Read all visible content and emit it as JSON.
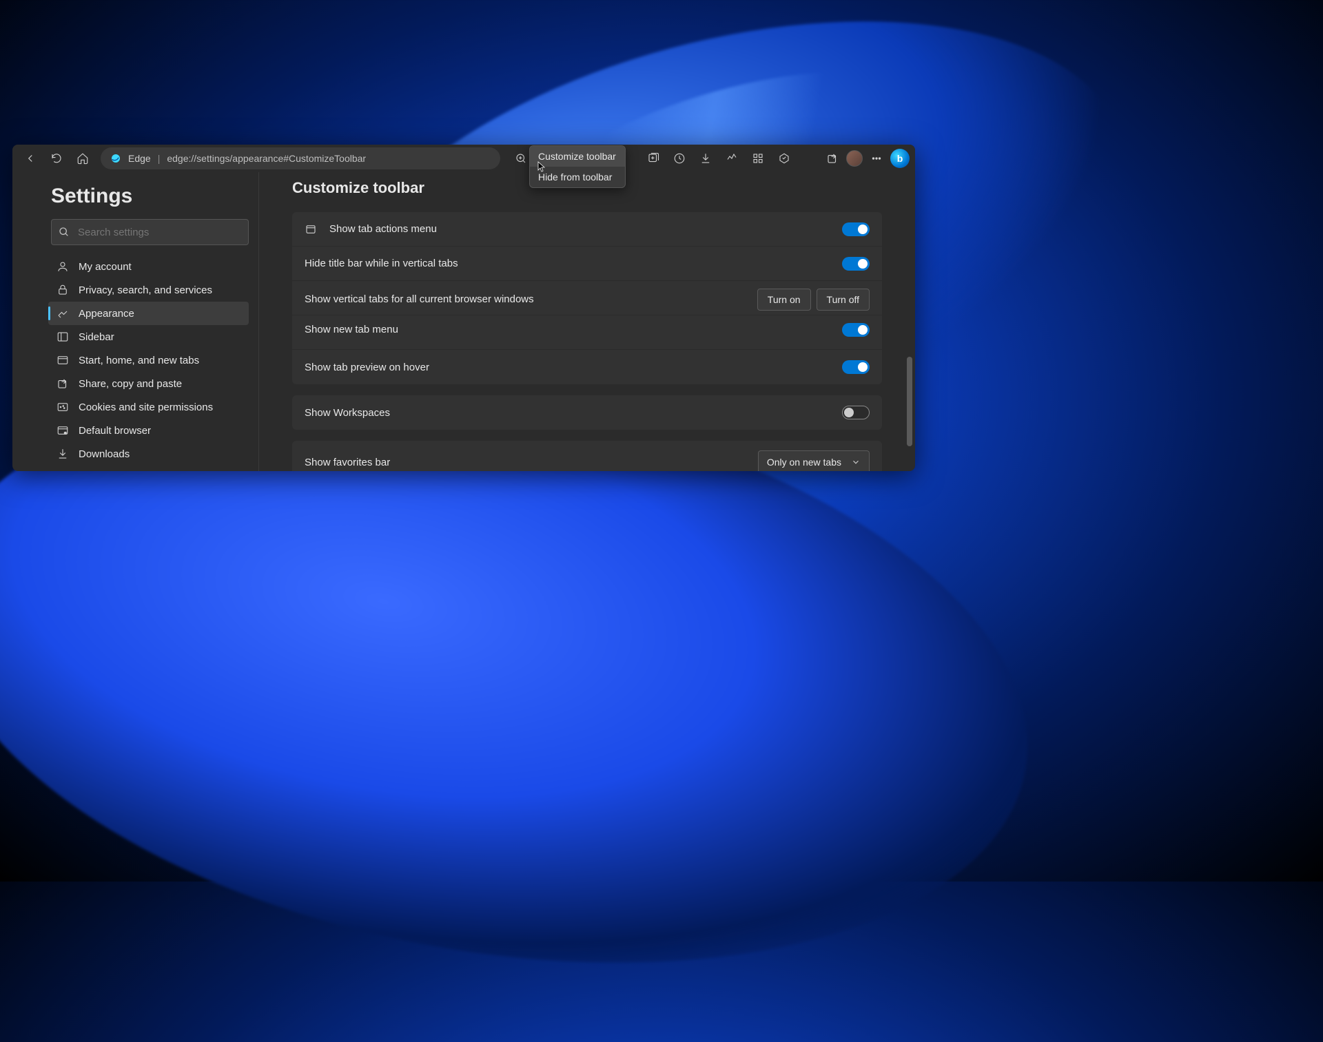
{
  "toolbar": {
    "edge_label": "Edge",
    "url": "edge://settings/appearance#CustomizeToolbar"
  },
  "context_menu": {
    "items": [
      {
        "label": "Customize toolbar"
      },
      {
        "label": "Hide from toolbar"
      }
    ]
  },
  "sidebar": {
    "title": "Settings",
    "search_placeholder": "Search settings",
    "items": [
      {
        "label": "My account"
      },
      {
        "label": "Privacy, search, and services"
      },
      {
        "label": "Appearance"
      },
      {
        "label": "Sidebar"
      },
      {
        "label": "Start, home, and new tabs"
      },
      {
        "label": "Share, copy and paste"
      },
      {
        "label": "Cookies and site permissions"
      },
      {
        "label": "Default browser"
      },
      {
        "label": "Downloads"
      }
    ]
  },
  "main": {
    "heading": "Customize toolbar",
    "rows": {
      "tab_actions": "Show tab actions menu",
      "hide_title": "Hide title bar while in vertical tabs",
      "vertical_tabs": "Show vertical tabs for all current browser windows",
      "turn_on": "Turn on",
      "turn_off": "Turn off",
      "new_tab_menu": "Show new tab menu",
      "tab_preview": "Show tab preview on hover",
      "workspaces": "Show Workspaces",
      "favorites_bar": "Show favorites bar",
      "favorites_value": "Only on new tabs"
    }
  }
}
